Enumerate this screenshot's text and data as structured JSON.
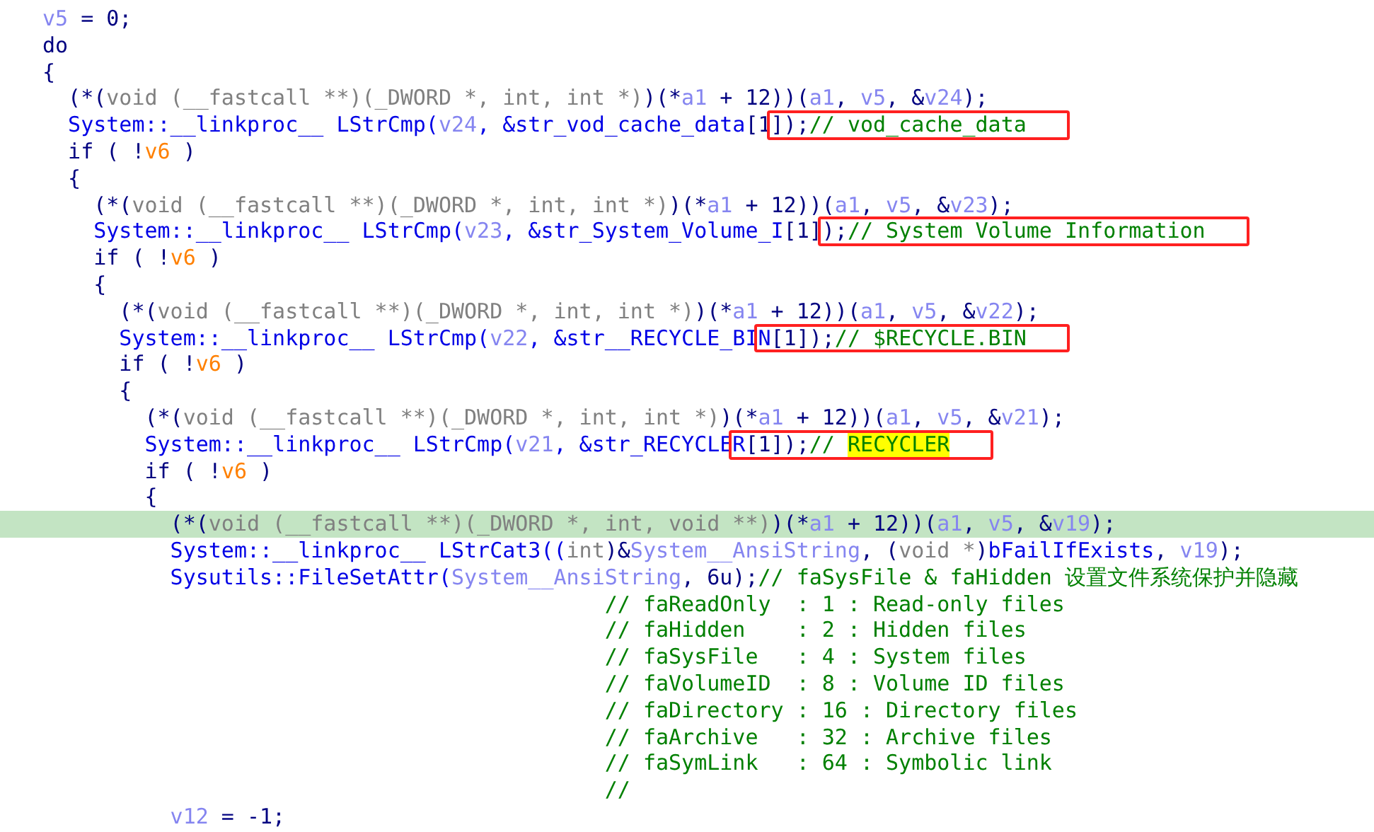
{
  "lines": [
    {
      "current": false,
      "boxed": false,
      "tokens": [
        {
          "kind": "var",
          "text": "v5"
        },
        {
          "kind": "text",
          "text": " = 0;"
        }
      ]
    },
    {
      "current": false,
      "boxed": false,
      "tokens": [
        {
          "kind": "text",
          "text": "do"
        }
      ]
    },
    {
      "current": false,
      "boxed": false,
      "tokens": [
        {
          "kind": "text",
          "text": "{"
        }
      ]
    },
    {
      "current": false,
      "boxed": false,
      "tokens": [
        {
          "kind": "text",
          "text": "  (*("
        },
        {
          "kind": "type",
          "text": "void (__fastcall **)(_DWORD *, int, int *)"
        },
        {
          "kind": "text",
          "text": ")(*"
        },
        {
          "kind": "var",
          "text": "a1"
        },
        {
          "kind": "text",
          "text": " + 12))("
        },
        {
          "kind": "var",
          "text": "a1"
        },
        {
          "kind": "text",
          "text": ", "
        },
        {
          "kind": "var",
          "text": "v5"
        },
        {
          "kind": "text",
          "text": ", &"
        },
        {
          "kind": "var",
          "text": "v24"
        },
        {
          "kind": "text",
          "text": ");"
        }
      ]
    },
    {
      "current": false,
      "boxed": true,
      "tokens": [
        {
          "kind": "call",
          "text": "  System::__linkproc__ LStrCmp("
        },
        {
          "kind": "var",
          "text": "v24"
        },
        {
          "kind": "call",
          "text": ", &str_vod_cache_data"
        },
        {
          "kind": "text",
          "text": "[1"
        },
        {
          "kind": "text",
          "text": "]);",
          "box_start": true
        },
        {
          "kind": "comment",
          "text": "// vod_cache_data"
        }
      ]
    },
    {
      "current": false,
      "boxed": false,
      "tokens": [
        {
          "kind": "text",
          "text": "  if ( !"
        },
        {
          "kind": "flag",
          "text": "v6"
        },
        {
          "kind": "text",
          "text": " )"
        }
      ]
    },
    {
      "current": false,
      "boxed": false,
      "tokens": [
        {
          "kind": "text",
          "text": "  {"
        }
      ]
    },
    {
      "current": false,
      "boxed": false,
      "tokens": [
        {
          "kind": "text",
          "text": "    (*("
        },
        {
          "kind": "type",
          "text": "void (__fastcall **)(_DWORD *, int, int *)"
        },
        {
          "kind": "text",
          "text": ")(*"
        },
        {
          "kind": "var",
          "text": "a1"
        },
        {
          "kind": "text",
          "text": " + 12))("
        },
        {
          "kind": "var",
          "text": "a1"
        },
        {
          "kind": "text",
          "text": ", "
        },
        {
          "kind": "var",
          "text": "v5"
        },
        {
          "kind": "text",
          "text": ", &"
        },
        {
          "kind": "var",
          "text": "v23"
        },
        {
          "kind": "text",
          "text": ");"
        }
      ]
    },
    {
      "current": false,
      "boxed": true,
      "tokens": [
        {
          "kind": "call",
          "text": "    System::__linkproc__ LStrCmp("
        },
        {
          "kind": "var",
          "text": "v23"
        },
        {
          "kind": "call",
          "text": ", &str_System_Volume_I"
        },
        {
          "kind": "text",
          "text": "[1]"
        },
        {
          "kind": "text",
          "text": ");",
          "box_start": true
        },
        {
          "kind": "comment",
          "text": "// System Volume Information"
        }
      ]
    },
    {
      "current": false,
      "boxed": false,
      "tokens": [
        {
          "kind": "text",
          "text": "    if ( !"
        },
        {
          "kind": "flag",
          "text": "v6"
        },
        {
          "kind": "text",
          "text": " )"
        }
      ]
    },
    {
      "current": false,
      "boxed": false,
      "tokens": [
        {
          "kind": "text",
          "text": "    {"
        }
      ]
    },
    {
      "current": false,
      "boxed": false,
      "tokens": [
        {
          "kind": "text",
          "text": "      (*("
        },
        {
          "kind": "type",
          "text": "void (__fastcall **)(_DWORD *, int, int *)"
        },
        {
          "kind": "text",
          "text": ")(*"
        },
        {
          "kind": "var",
          "text": "a1"
        },
        {
          "kind": "text",
          "text": " + 12))("
        },
        {
          "kind": "var",
          "text": "a1"
        },
        {
          "kind": "text",
          "text": ", "
        },
        {
          "kind": "var",
          "text": "v5"
        },
        {
          "kind": "text",
          "text": ", &"
        },
        {
          "kind": "var",
          "text": "v22"
        },
        {
          "kind": "text",
          "text": ");"
        }
      ]
    },
    {
      "current": false,
      "boxed": true,
      "tokens": [
        {
          "kind": "call",
          "text": "      System::__linkproc__ LStrCmp("
        },
        {
          "kind": "var",
          "text": "v22"
        },
        {
          "kind": "call",
          "text": ", &str__RECYCLE_BI"
        },
        {
          "kind": "call",
          "text": "N",
          "box_start": true
        },
        {
          "kind": "text",
          "text": "[1]);"
        },
        {
          "kind": "comment",
          "text": "// $RECYCLE.BIN"
        }
      ]
    },
    {
      "current": false,
      "boxed": false,
      "tokens": [
        {
          "kind": "text",
          "text": "      if ( !"
        },
        {
          "kind": "flag",
          "text": "v6"
        },
        {
          "kind": "text",
          "text": " )"
        }
      ]
    },
    {
      "current": false,
      "boxed": false,
      "tokens": [
        {
          "kind": "text",
          "text": "      {"
        }
      ]
    },
    {
      "current": false,
      "boxed": false,
      "tokens": [
        {
          "kind": "text",
          "text": "        (*("
        },
        {
          "kind": "type",
          "text": "void (__fastcall **)(_DWORD *, int, int *)"
        },
        {
          "kind": "text",
          "text": ")(*"
        },
        {
          "kind": "var",
          "text": "a1"
        },
        {
          "kind": "text",
          "text": " + 12))("
        },
        {
          "kind": "var",
          "text": "a1"
        },
        {
          "kind": "text",
          "text": ", "
        },
        {
          "kind": "var",
          "text": "v5"
        },
        {
          "kind": "text",
          "text": ", &"
        },
        {
          "kind": "var",
          "text": "v21"
        },
        {
          "kind": "text",
          "text": ");"
        }
      ]
    },
    {
      "current": false,
      "boxed": true,
      "tokens": [
        {
          "kind": "call",
          "text": "        System::__linkproc__ LStrCmp("
        },
        {
          "kind": "var",
          "text": "v21"
        },
        {
          "kind": "call",
          "text": ", &str_RECYCLE"
        },
        {
          "kind": "call",
          "text": "R",
          "box_start": true
        },
        {
          "kind": "text",
          "text": "[1]);"
        },
        {
          "kind": "comment",
          "text": "// "
        },
        {
          "kind": "marked",
          "text": "RECYCLER"
        }
      ]
    },
    {
      "current": false,
      "boxed": false,
      "tokens": [
        {
          "kind": "text",
          "text": "        if ( !"
        },
        {
          "kind": "flag",
          "text": "v6"
        },
        {
          "kind": "text",
          "text": " )"
        }
      ]
    },
    {
      "current": false,
      "boxed": false,
      "tokens": [
        {
          "kind": "text",
          "text": "        {"
        }
      ]
    },
    {
      "current": true,
      "boxed": false,
      "tokens": [
        {
          "kind": "text",
          "text": "          (*("
        },
        {
          "kind": "type",
          "text": "void (__fastcall **)(_DWORD *, int, void **)"
        },
        {
          "kind": "text",
          "text": ")(*"
        },
        {
          "kind": "var",
          "text": "a1"
        },
        {
          "kind": "text",
          "text": " + 12))("
        },
        {
          "kind": "var",
          "text": "a1"
        },
        {
          "kind": "text",
          "text": ", "
        },
        {
          "kind": "var",
          "text": "v5"
        },
        {
          "kind": "text",
          "text": ", &"
        },
        {
          "kind": "var",
          "text": "v19"
        },
        {
          "kind": "text",
          "text": ");"
        }
      ]
    },
    {
      "current": false,
      "boxed": false,
      "tokens": [
        {
          "kind": "call",
          "text": "          System::__linkproc__ LStrCat3(("
        },
        {
          "kind": "type",
          "text": "int"
        },
        {
          "kind": "text",
          "text": ")&"
        },
        {
          "kind": "var",
          "text": "System__AnsiString"
        },
        {
          "kind": "text",
          "text": ", ("
        },
        {
          "kind": "type",
          "text": "void *"
        },
        {
          "kind": "text",
          "text": ")"
        },
        {
          "kind": "call",
          "text": "bFailIfExists"
        },
        {
          "kind": "text",
          "text": ", "
        },
        {
          "kind": "var",
          "text": "v19"
        },
        {
          "kind": "text",
          "text": ");"
        }
      ]
    },
    {
      "current": false,
      "boxed": false,
      "tokens": [
        {
          "kind": "call",
          "text": "          Sysutils::FileSetAttr("
        },
        {
          "kind": "var",
          "text": "System__AnsiString"
        },
        {
          "kind": "text",
          "text": ", 6u);"
        },
        {
          "kind": "comment",
          "text": "// faSysFile & faHidden 设置文件系统保护并隐藏"
        }
      ]
    },
    {
      "current": false,
      "boxed": false,
      "tokens": [
        {
          "kind": "comment",
          "text": "                                            // faReadOnly  : 1 : Read-only files"
        }
      ]
    },
    {
      "current": false,
      "boxed": false,
      "tokens": [
        {
          "kind": "comment",
          "text": "                                            // faHidden    : 2 : Hidden files"
        }
      ]
    },
    {
      "current": false,
      "boxed": false,
      "tokens": [
        {
          "kind": "comment",
          "text": "                                            // faSysFile   : 4 : System files"
        }
      ]
    },
    {
      "current": false,
      "boxed": false,
      "tokens": [
        {
          "kind": "comment",
          "text": "                                            // faVolumeID  : 8 : Volume ID files"
        }
      ]
    },
    {
      "current": false,
      "boxed": false,
      "tokens": [
        {
          "kind": "comment",
          "text": "                                            // faDirectory : 16 : Directory files"
        }
      ]
    },
    {
      "current": false,
      "boxed": false,
      "tokens": [
        {
          "kind": "comment",
          "text": "                                            // faArchive   : 32 : Archive files"
        }
      ]
    },
    {
      "current": false,
      "boxed": false,
      "tokens": [
        {
          "kind": "comment",
          "text": "                                            // faSymLink   : 64 : Symbolic link"
        }
      ]
    },
    {
      "current": false,
      "boxed": false,
      "tokens": [
        {
          "kind": "comment",
          "text": "                                            //"
        }
      ]
    },
    {
      "current": false,
      "boxed": false,
      "tokens": [
        {
          "kind": "var",
          "text": "          v12"
        },
        {
          "kind": "text",
          "text": " = -1;"
        }
      ]
    }
  ]
}
